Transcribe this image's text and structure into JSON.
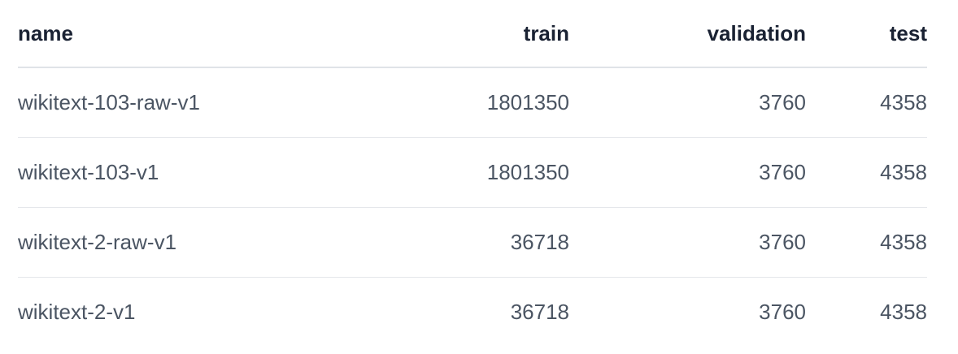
{
  "table": {
    "headers": {
      "name": "name",
      "train": "train",
      "validation": "validation",
      "test": "test"
    },
    "rows": [
      {
        "name": "wikitext-103-raw-v1",
        "train": "1801350",
        "validation": "3760",
        "test": "4358"
      },
      {
        "name": "wikitext-103-v1",
        "train": "1801350",
        "validation": "3760",
        "test": "4358"
      },
      {
        "name": "wikitext-2-raw-v1",
        "train": "36718",
        "validation": "3760",
        "test": "4358"
      },
      {
        "name": "wikitext-2-v1",
        "train": "36718",
        "validation": "3760",
        "test": "4358"
      }
    ]
  }
}
